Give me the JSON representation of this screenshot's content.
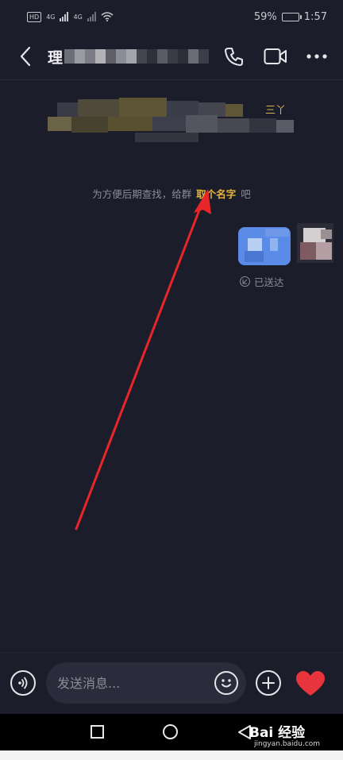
{
  "status_bar": {
    "net_badge": "HD",
    "signal_1": "4G",
    "signal_2": "4G",
    "battery_percent": "59%",
    "battery_level": 0.59,
    "time": "1:57"
  },
  "header": {
    "title": "理",
    "icons": [
      "chevron-left-icon",
      "phone-icon",
      "video-icon",
      "more-icon"
    ]
  },
  "chat": {
    "system_tag": "三丫",
    "hint_before": "为方便后期查找，给群",
    "hint_link": "取个名字",
    "hint_after": "吧",
    "delivered_label": "已送达"
  },
  "input_bar": {
    "placeholder": "发送消息...",
    "icons": [
      "voice-icon",
      "emoji-icon",
      "plus-icon",
      "heart-icon"
    ]
  },
  "nav_bar": {
    "icons": [
      "recent-apps-icon",
      "home-icon",
      "back-icon"
    ]
  },
  "watermark": {
    "brand": "Bai 经验",
    "url": "jingyan.baidu.com"
  },
  "colors": {
    "background": "#1c1d2b",
    "accent_link": "#e7b53c",
    "bubble": "#5a8be6",
    "arrow": "#e8262a",
    "heart": "#e8343c"
  }
}
